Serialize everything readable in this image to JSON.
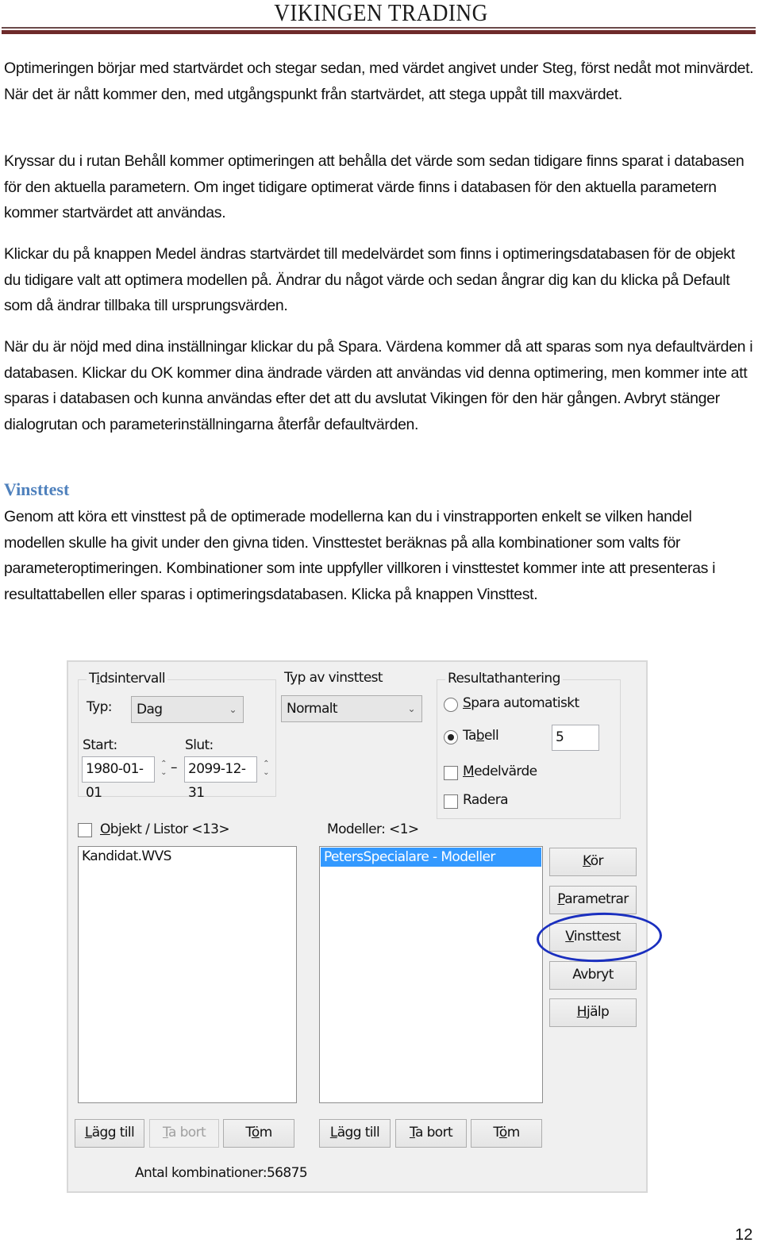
{
  "header": {
    "title": "VIKINGEN TRADING"
  },
  "paragraphs": [
    "Optimeringen börjar med startvärdet och stegar sedan, med värdet angivet under Steg, först nedåt mot minvärdet. När det är nått kommer den, med utgångspunkt från startvärdet, att stega uppåt till maxvärdet.",
    "Kryssar du i rutan Behåll kommer optimeringen att behålla det värde som sedan tidigare finns sparat i databasen för den aktuella parametern. Om inget tidigare optimerat värde finns i databasen för den aktuella parametern kommer startvärdet att användas.",
    "Klickar du på knappen Medel ändras startvärdet till medelvärdet som finns i optimeringsdatabasen för de objekt du tidigare valt att optimera modellen på. Ändrar du något värde och sedan ångrar dig kan du klicka på Default som då ändrar tillbaka till ursprungsvärden.",
    "När du är nöjd med dina inställningar klickar du på Spara. Värdena kommer då att sparas som nya defaultvärden i databasen. Klickar du OK kommer dina ändrade värden att användas vid denna optimering, men kommer inte att sparas i databasen och kunna användas efter det att du avslutat Vikingen för den här gången. Avbryt stänger dialogrutan och parameterinställningarna återfår defaultvärden."
  ],
  "section": {
    "heading": "Vinsttest",
    "paragraph": "Genom att köra ett vinsttest på de optimerade modellerna kan du i vinstrapporten enkelt se vilken handel modellen skulle ha givit under den givna tiden. Vinsttestet beräknas på alla kombinationer som valts för parameteroptimeringen. Kombinationer som inte uppfyller villkoren i vinsttestet kommer inte att presenteras i resultattabellen eller sparas i optimeringsdatabasen. Klicka på knappen Vinsttest."
  },
  "dialog": {
    "tidsintervall": {
      "legend_pre": "T",
      "legend_u": "i",
      "legend_post": "dsintervall",
      "typ_label": "Typ:",
      "typ_value": "Dag",
      "start_label": "Start:",
      "start_value": "1980-01-01",
      "dash": "–",
      "slut_label": "Slut:",
      "slut_value": "2099-12-31"
    },
    "vinsttest_typ": {
      "label": "Typ av vinsttest",
      "value": "Normalt"
    },
    "resultathantering": {
      "legend": "Resultathantering",
      "spara_u": "S",
      "spara_rest": "para automatiskt",
      "spara_checked": false,
      "tabell_pre": "Ta",
      "tabell_u": "b",
      "tabell_post": "ell",
      "tabell_checked": true,
      "tabell_value": "5",
      "medel_u": "M",
      "medel_rest": "edelvärde",
      "medel_checked": false,
      "radera": "Radera",
      "radera_checked": false
    },
    "objekt": {
      "checked": false,
      "label_u": "O",
      "label_rest": "bjekt / Listor <13>",
      "items": [
        "Kandidat.WVS"
      ]
    },
    "modeller": {
      "label": "Modeller: <1>",
      "items": [
        "PetersSpecialare - Modeller"
      ],
      "selected_index": 0
    },
    "side_buttons": {
      "kor_u": "K",
      "kor_rest": "ör",
      "param_u": "P",
      "param_rest": "arametrar",
      "vinsttest_u": "V",
      "vinsttest_rest": "insttest",
      "avbryt": "Avbryt",
      "hjalp_u": "H",
      "hjalp_rest": "jälp"
    },
    "objekt_buttons": {
      "lagg_u": "L",
      "lagg_rest": "ägg till",
      "tabort_u": "T",
      "tabort_rest": "a bort",
      "tom_pre": "T",
      "tom_u": "ö",
      "tom_post": "m"
    },
    "modell_buttons": {
      "lagg_u": "L",
      "lagg_rest": "ägg till",
      "tabort_u": "T",
      "tabort_rest": "a bort",
      "tom_pre": "T",
      "tom_u": "ö",
      "tom_post": "m"
    },
    "antal_kombinationer": "Antal kombinationer:56875"
  },
  "annotation": {
    "color": "#1a2fbf",
    "target": "Vinsttest"
  },
  "page_number": "12"
}
